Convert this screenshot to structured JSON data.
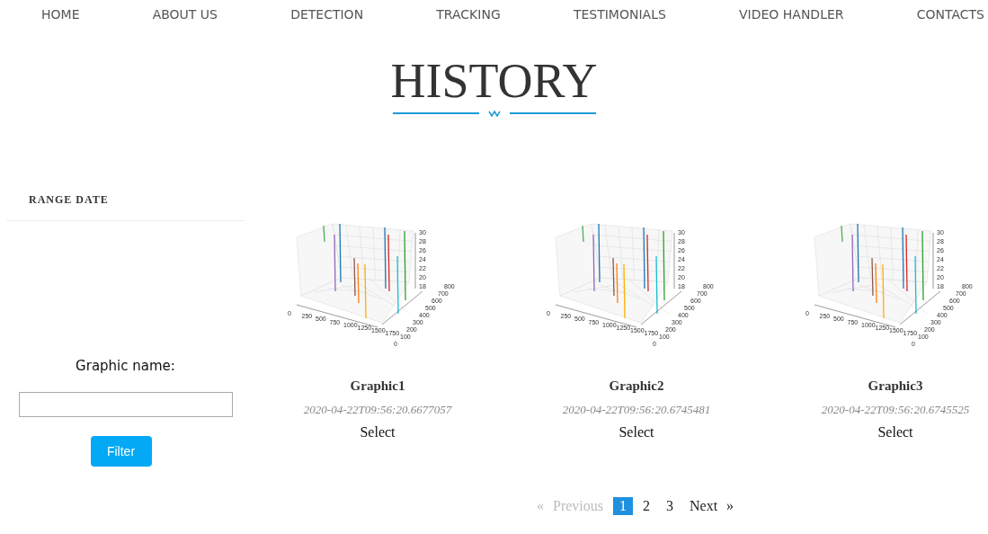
{
  "nav": [
    "HOME",
    "ABOUT US",
    "DETECTION",
    "TRACKING",
    "TESTIMONIALS",
    "VIDEO HANDLER",
    "CONTACTS"
  ],
  "title": "HISTORY",
  "sidebar": {
    "heading": "RANGE DATE",
    "field_label": "Graphic name:",
    "button": "Filter"
  },
  "graphics": [
    {
      "name": "Graphic1",
      "date": "2020-04-22T09:56:20.6677057",
      "action": "Select",
      "plot": {
        "z_ticks": [
          "30",
          "28",
          "26",
          "24",
          "22",
          "20",
          "18"
        ],
        "x_ticks": [
          "0",
          "250",
          "500",
          "750",
          "1000",
          "1250",
          "1500",
          "1750"
        ],
        "y_ticks": [
          "800",
          "700",
          "600",
          "500",
          "400",
          "300",
          "200",
          "100",
          "0"
        ]
      }
    },
    {
      "name": "Graphic2",
      "date": "2020-04-22T09:56:20.6745481",
      "action": "Select",
      "plot": {
        "z_ticks": [
          "30",
          "28",
          "26",
          "24",
          "22",
          "20",
          "18"
        ],
        "x_ticks": [
          "0",
          "250",
          "500",
          "750",
          "1000",
          "1250",
          "1500",
          "1750"
        ],
        "y_ticks": [
          "800",
          "700",
          "600",
          "500",
          "400",
          "300",
          "200",
          "100",
          "0"
        ]
      }
    },
    {
      "name": "Graphic3",
      "date": "2020-04-22T09:56:20.6745525",
      "action": "Select",
      "plot": {
        "z_ticks": [
          "30",
          "28",
          "26",
          "24",
          "22",
          "20",
          "18"
        ],
        "x_ticks": [
          "0",
          "250",
          "500",
          "750",
          "1000",
          "1250",
          "1500",
          "1750"
        ],
        "y_ticks": [
          "800",
          "700",
          "600",
          "500",
          "400",
          "300",
          "200",
          "100",
          "0"
        ]
      }
    }
  ],
  "pagination": {
    "previous": {
      "label": "« Previous",
      "disabled": true
    },
    "pages": [
      {
        "label": "1",
        "selected": true
      },
      {
        "label": "2",
        "selected": false
      },
      {
        "label": "3",
        "selected": false
      }
    ],
    "next": {
      "label": "Next »",
      "disabled": false
    }
  }
}
